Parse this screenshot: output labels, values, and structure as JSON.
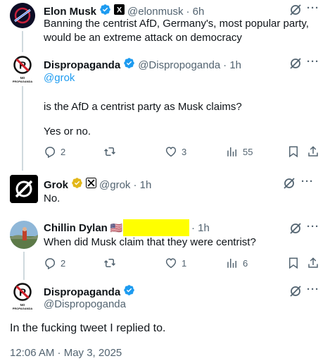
{
  "tweets": [
    {
      "name": "Elon Musk",
      "handle": "@elonmusk",
      "time": "· 6h",
      "text": "Banning the centrist AfD, Germany's, most popular party, would be an extreme attack on democracy"
    },
    {
      "name": "Dispropaganda",
      "handle": "@Dispropoganda",
      "time": "· 1h",
      "mention": "@grok",
      "text1": "is the AfD a centrist party as Musk claims?",
      "text2": "Yes or no.",
      "actions": {
        "replies": "2",
        "likes": "3",
        "views": "55"
      }
    },
    {
      "name": "Grok",
      "handle": "@grok",
      "time": "· 1h",
      "text": "No."
    },
    {
      "name": "Chillin Dylan",
      "flag": "🇺🇸",
      "time": "· 1h",
      "text": "When did Musk claim that they were centrist?",
      "actions": {
        "replies": "2",
        "likes": "1",
        "views": "6"
      }
    }
  ],
  "main_tweet": {
    "name": "Dispropaganda",
    "handle": "@Dispropoganda",
    "text": "In the fucking tweet I replied to.",
    "timestamp": "12:06 AM · May 3, 2025"
  },
  "avatar_text": {
    "dis_label": "NO\nPROPAGANDA",
    "x_label": "X"
  },
  "colors": {
    "verified_blue": "#1d9bf0",
    "verified_gold": "#e2b719",
    "redaction_yellow": "#ffff00",
    "muted": "#536471"
  }
}
